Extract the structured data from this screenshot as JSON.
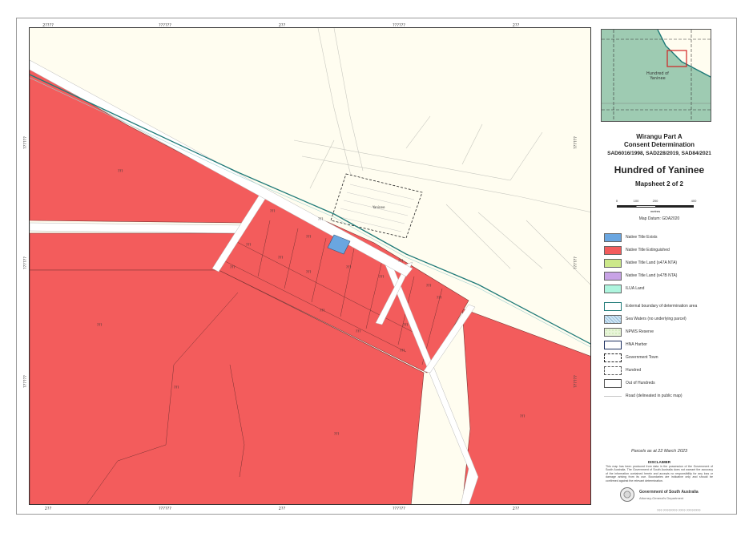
{
  "map": {
    "top_ticks": [
      "2????",
      "??????",
      "2??",
      "??????",
      "2??"
    ],
    "bottom_ticks": [
      "2??",
      "??????",
      "2??",
      "??????",
      "2??"
    ],
    "left_ticks": [
      "??????",
      "??????",
      "??????"
    ],
    "right_ticks": [
      "??????",
      "??????",
      "??????"
    ],
    "township_label": "Yaninee",
    "parcel_labels": [
      "???",
      "???",
      "???",
      "???",
      "???",
      "???",
      "???",
      "???",
      "???",
      "???",
      "???",
      "???",
      "???",
      "???",
      "???",
      "???",
      "???",
      "???",
      "???",
      "???",
      "???"
    ],
    "colors": {
      "extinguished": "#f35c5c",
      "exists": "#6aa6e0",
      "background": "#fffdf0",
      "road": "#ffffff",
      "boundary": "#1f7a78"
    }
  },
  "inset": {
    "label_line1": "Hundred of",
    "label_line2": "Yaninee"
  },
  "titles": {
    "project_line1": "Wirangu Part A",
    "project_line2": "Consent Determination",
    "case_numbers": "SAD6016/1998, SAD228/2019, SAD84/2021",
    "hundred": "Hundred of Yaninee",
    "mapsheet": "Mapsheet 2 of 2"
  },
  "scale": {
    "ticks": [
      "0",
      "100",
      "200",
      "400"
    ],
    "unit": "metres",
    "datum": "Map Datum: GDA2020"
  },
  "legend": [
    {
      "label": "Native Title Exists",
      "swatch": "#6aa6e0",
      "icon": "fill-swatch"
    },
    {
      "label": "Native Title Extinguished",
      "swatch": "#f35c5c",
      "icon": "fill-swatch"
    },
    {
      "label": "Native Title Land (s47A NTA)",
      "swatch": "#cce88a",
      "icon": "fill-swatch"
    },
    {
      "label": "Native Title Land (s47B NTA)",
      "swatch": "#c8a3e6",
      "icon": "fill-swatch"
    },
    {
      "label": "ILUA Land",
      "swatch": "#aef5de",
      "icon": "fill-swatch"
    },
    {
      "label": "External boundary of determination area",
      "swatch": "#ffffff",
      "icon": "outline-teal"
    },
    {
      "label": "Sea Waters (no underlying parcel)",
      "swatch": "#cfe6f5",
      "icon": "hatch-swatch"
    },
    {
      "label": "NPWS Reserve",
      "swatch": "#e8f5d8",
      "icon": "dot-swatch"
    },
    {
      "label": "HNA Harbor",
      "swatch": "#ffffff",
      "icon": "outline-navy"
    },
    {
      "label": "Government Town",
      "swatch": "#ffffff",
      "icon": "dashed-outline"
    },
    {
      "label": "Hundred",
      "swatch": "#ffffff",
      "icon": "long-dash-outline"
    },
    {
      "label": "Out of Hundreds",
      "swatch": "#ffffff",
      "icon": "plain-outline"
    },
    {
      "label": "Road (delineated in public map)",
      "swatch": "#ffffff",
      "icon": "road-line"
    }
  ],
  "footer": {
    "date": "Parcels as at 22 March 2023",
    "disclaimer_title": "DISCLAIMER",
    "disclaimer_body": "This map has been produced from data in the possession of the Government of South Australia. The Government of South Australia does not warrant the accuracy of the information contained herein and accepts no responsibility for any loss or damage arising from its use. Boundaries are indicative only and should be confirmed against the relevant determination.",
    "gov_name": "Government of South Australia",
    "gov_dept": "Attorney-General's Department",
    "ref": "??? ???????? ???? ????????"
  }
}
